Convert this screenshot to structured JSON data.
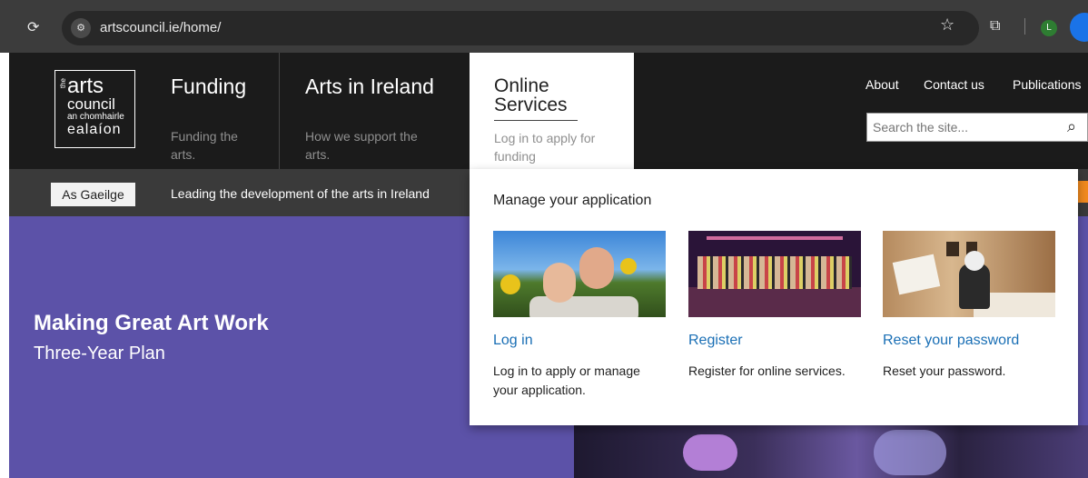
{
  "browser": {
    "url": "artscouncil.ie/home/",
    "reload_icon": "reload-icon",
    "site_info_icon": "site-settings-icon",
    "bookmark_icon": "star-icon",
    "extensions_icon": "puzzle-icon",
    "profile_initial": "L"
  },
  "logo": {
    "the": "the",
    "arts": "arts",
    "council": "council",
    "chomhairle": "an chomhairle",
    "ealaion": "ealaíon"
  },
  "nav": {
    "funding": {
      "title": "Funding",
      "desc": "Funding the arts."
    },
    "arts_in_ireland": {
      "title": "Arts in Ireland",
      "desc": "How we support the arts."
    },
    "online_services": {
      "title_line1": "Online",
      "title_line2": "Services",
      "desc": "Log in to apply for funding"
    }
  },
  "utility": {
    "about": "About",
    "contact": "Contact us",
    "publications": "Publications"
  },
  "search": {
    "placeholder": "Search the site..."
  },
  "sub_bar": {
    "gaeilge": "As Gaeilge",
    "tagline": "Leading the development of the arts in Ireland"
  },
  "hero": {
    "title": "Making Great Art Work",
    "subtitle": "Three-Year Plan"
  },
  "dropdown": {
    "heading": "Manage your application",
    "cards": [
      {
        "link": "Log in",
        "text": "Log in to apply or manage your application."
      },
      {
        "link": "Register",
        "text": "Register for online services."
      },
      {
        "link": "Reset your password",
        "text": "Reset your password."
      }
    ]
  },
  "colors": {
    "header_bg": "#1b1b1b",
    "sub_bar_bg": "#3a3a3a",
    "hero_bg": "#5c52a8",
    "link": "#1a6fb5",
    "rss": "#f28a1e"
  }
}
